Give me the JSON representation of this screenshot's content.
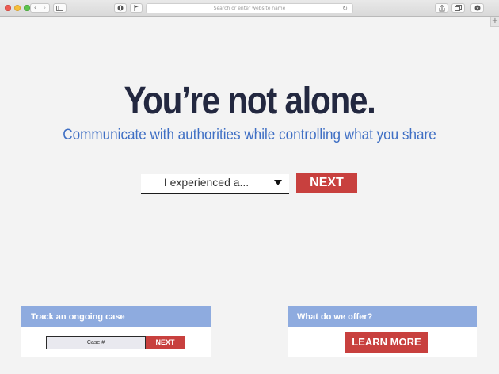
{
  "browser": {
    "url_placeholder": "Search or enter website name",
    "icons": {
      "back": "chevron-left-icon",
      "forward": "chevron-right-icon",
      "sidebar": "sidebar-icon",
      "privacy": "shield-icon",
      "bookmark": "flag-icon",
      "reload": "reload-icon",
      "share": "share-icon",
      "tabs": "tabs-icon",
      "download": "download-icon",
      "new_tab": "plus-icon"
    }
  },
  "hero": {
    "title": "You’re not alone.",
    "subtitle": "Communicate with authorities while controlling what you share",
    "select_value": "I experienced a...",
    "next_label": "NEXT"
  },
  "track_card": {
    "heading": "Track an ongoing case",
    "case_placeholder": "Case #",
    "next_label": "NEXT"
  },
  "offer_card": {
    "heading": "What do we offer?",
    "learn_more_label": "LEARN MORE"
  },
  "colors": {
    "title": "#232840",
    "subtitle": "#3f6fc4",
    "accent_red": "#c8403e",
    "card_header": "#8eabdf",
    "page_background": "#f3f3f3"
  }
}
